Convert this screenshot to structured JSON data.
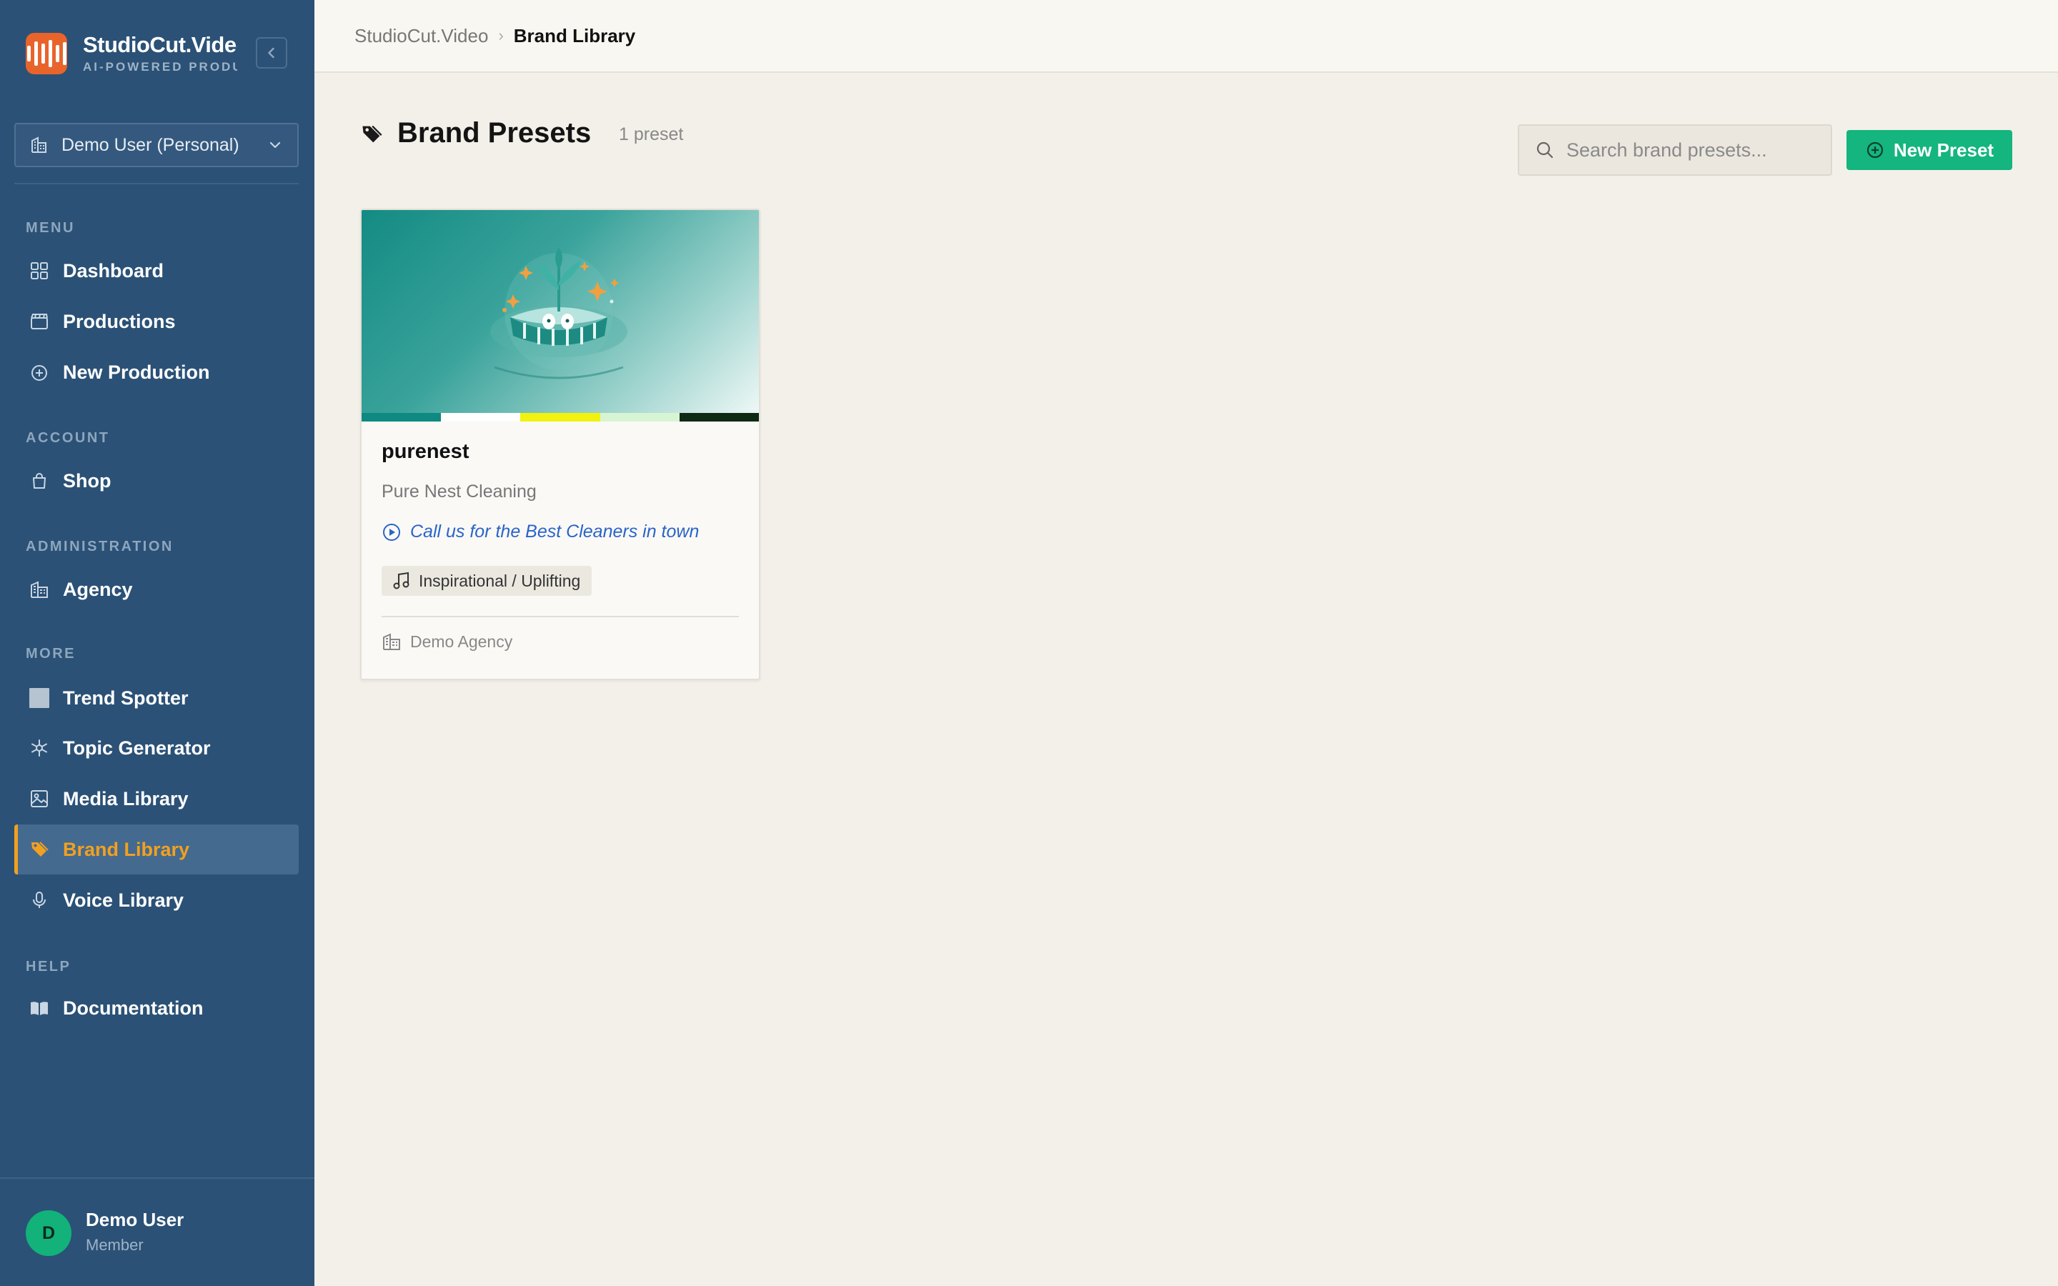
{
  "app": {
    "name": "StudioCut.Video",
    "tagline": "AI-POWERED PRODUCTION"
  },
  "account": {
    "selected": "Demo User (Personal)"
  },
  "sidebar": {
    "sections": {
      "menu": "MENU",
      "account": "ACCOUNT",
      "administration": "ADMINISTRATION",
      "more": "MORE",
      "help": "HELP"
    },
    "items": {
      "dashboard": "Dashboard",
      "productions": "Productions",
      "new_production": "New Production",
      "shop": "Shop",
      "agency": "Agency",
      "trend_spotter": "Trend Spotter",
      "topic_generator": "Topic Generator",
      "media_library": "Media Library",
      "brand_library": "Brand Library",
      "voice_library": "Voice Library",
      "documentation": "Documentation"
    },
    "active": "brand_library"
  },
  "user": {
    "initial": "D",
    "name": "Demo User",
    "role": "Member"
  },
  "breadcrumb": {
    "root": "StudioCut.Video",
    "separator": "›",
    "current": "Brand Library"
  },
  "page": {
    "title": "Brand Presets",
    "count": "1 preset",
    "search_placeholder": "Search brand presets...",
    "new_button": "New Preset"
  },
  "presets": [
    {
      "name": "purenest",
      "company": "Pure Nest Cleaning",
      "tagline": "Call us for the Best Cleaners in town",
      "mood": "Inspirational / Uplifting",
      "agency": "Demo Agency",
      "palette": [
        "#0e8a82",
        "#ffffff",
        "#f2f20f",
        "#d7f5d3",
        "#0f2a14"
      ]
    }
  ],
  "colors": {
    "sidebar_bg": "#2b5176",
    "accent": "#f2a01f",
    "primary_button": "#14b57f",
    "brand_logo": "#e8642b"
  }
}
